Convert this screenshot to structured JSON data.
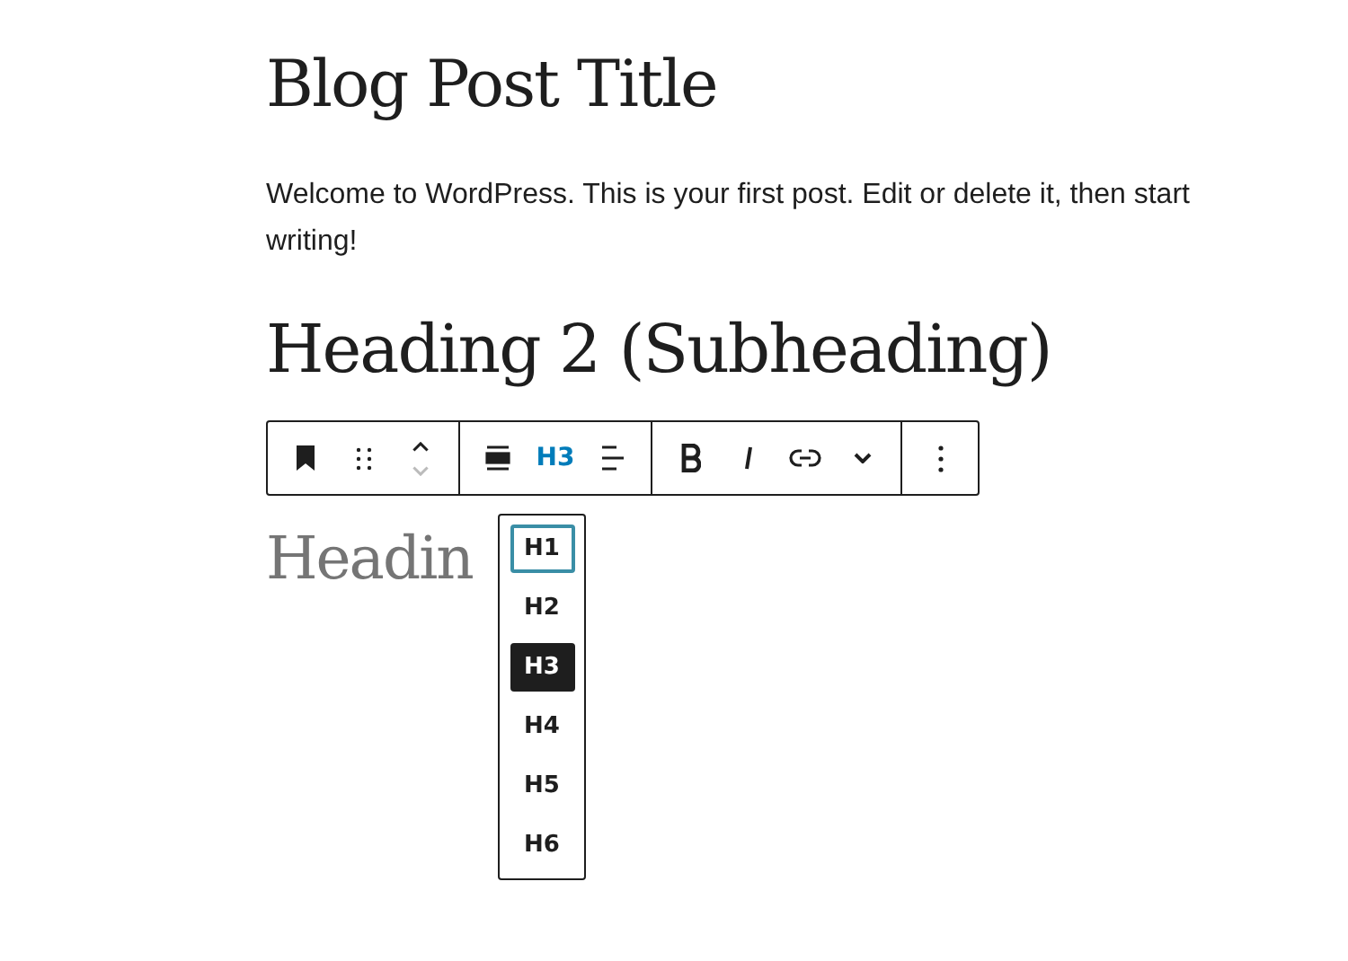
{
  "post_title": "Blog Post Title",
  "paragraph": "Welcome to WordPress. This is your first post. Edit or delete it, then start writing!",
  "subheading": "Heading 2 (Subheading)",
  "toolbar": {
    "groups": [
      {
        "items": [
          {
            "kind": "icon"
          },
          {
            "kind": "icon"
          },
          {
            "kind": "icon"
          }
        ]
      },
      {
        "items": [
          {
            "kind": "icon"
          },
          {
            "kind": "text",
            "label": "H3",
            "active": true
          },
          {
            "kind": "icon"
          }
        ]
      },
      {
        "items": [
          {
            "kind": "icon"
          },
          {
            "kind": "icon"
          },
          {
            "kind": "icon"
          },
          {
            "kind": "icon"
          }
        ]
      },
      {
        "items": [
          {
            "kind": "icon"
          }
        ]
      }
    ]
  },
  "heading_block": {
    "text": "Headin"
  },
  "level_menu": [
    {
      "label": "H1",
      "selected": false,
      "focused": true
    },
    {
      "label": "H2",
      "selected": false,
      "focused": false
    },
    {
      "label": "H3",
      "selected": true,
      "focused": false
    },
    {
      "label": "H4",
      "selected": false,
      "focused": false
    },
    {
      "label": "H5",
      "selected": false,
      "focused": false
    },
    {
      "label": "H6",
      "selected": false,
      "focused": false
    }
  ]
}
